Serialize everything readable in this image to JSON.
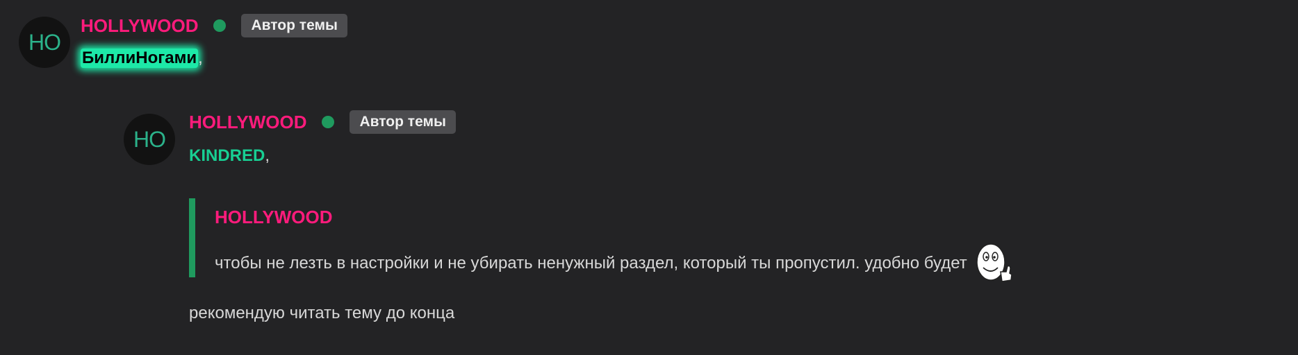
{
  "post1": {
    "avatar_initials": "HO",
    "username": "HOLLYWOOD",
    "badge": "Автор темы",
    "mention": "БиллиНогами",
    "mention_suffix": ","
  },
  "post2": {
    "avatar_initials": "HO",
    "username": "HOLLYWOOD",
    "badge": "Автор темы",
    "mention": "KINDRED",
    "mention_suffix": ",",
    "quote": {
      "author": "HOLLYWOOD",
      "text": "чтобы не лезть в настройки и не убирать ненужный раздел, который ты пропустил. удобно будет",
      "emoji_icon": "thumbs-up-smiley-icon"
    },
    "body": "рекомендую читать тему до конца"
  },
  "colors": {
    "background": "#232325",
    "username": "#ff1b7c",
    "online": "#1f9a5e",
    "mention": "#18cf93",
    "badge_bg": "#4c4c4f"
  }
}
